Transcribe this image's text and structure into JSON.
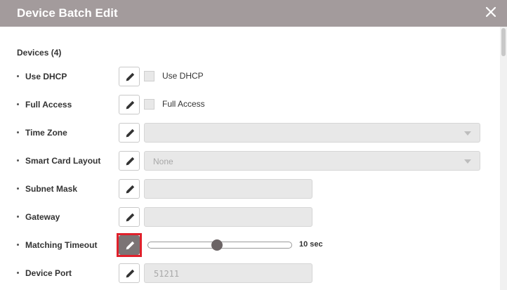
{
  "dialog": {
    "title": "Device Batch Edit",
    "close_icon": "close-icon"
  },
  "devices_header": "Devices (4)",
  "fields": {
    "use_dhcp": {
      "label": "Use DHCP",
      "checkbox_label": "Use DHCP",
      "checked": false
    },
    "full_access": {
      "label": "Full Access",
      "checkbox_label": "Full Access",
      "checked": false
    },
    "time_zone": {
      "label": "Time Zone",
      "value": ""
    },
    "smart_card_layout": {
      "label": "Smart Card Layout",
      "value": "None"
    },
    "subnet_mask": {
      "label": "Subnet Mask",
      "value": ""
    },
    "gateway": {
      "label": "Gateway",
      "value": ""
    },
    "matching_timeout": {
      "label": "Matching Timeout",
      "value_text": "10 sec",
      "slider_fraction": 0.48
    },
    "device_port": {
      "label": "Device Port",
      "value": "51211"
    }
  },
  "icons": {
    "edit": "pencil-icon",
    "dropdown": "chevron-down-icon"
  },
  "colors": {
    "header_bg": "#a39b9c",
    "active_edit_button": "#7b7475",
    "highlight_border": "#e0202b",
    "disabled_field": "#e8e8e8"
  }
}
